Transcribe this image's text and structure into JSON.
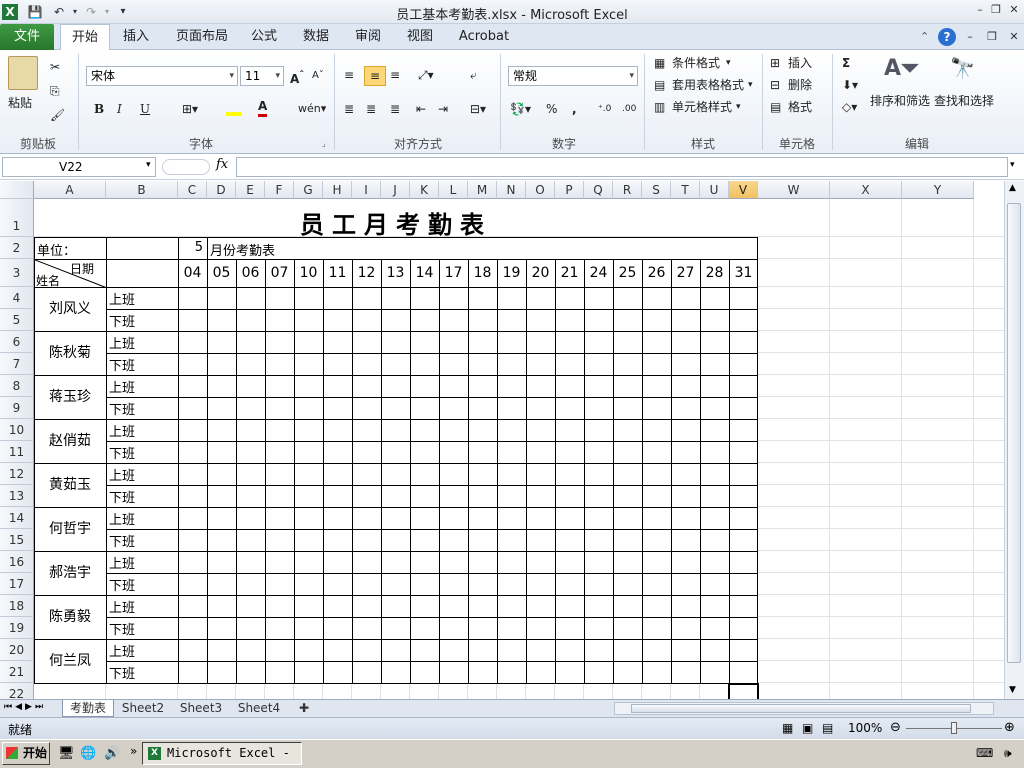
{
  "window": {
    "title": "员工基本考勤表.xlsx - Microsoft Excel",
    "controls": [
      "–",
      "❐",
      "✕"
    ]
  },
  "ribbon_tabs": [
    "文件",
    "开始",
    "插入",
    "页面布局",
    "公式",
    "数据",
    "审阅",
    "视图",
    "Acrobat"
  ],
  "ribbon": {
    "clipboard": {
      "paste": "粘贴",
      "label": "剪贴板"
    },
    "font": {
      "name": "宋体",
      "size": "11",
      "label": "字体",
      "bold": "B",
      "italic": "I",
      "underline": "U",
      "font_color": "#cc0000",
      "fill_color": "#ffff00"
    },
    "alignment": {
      "label": "对齐方式"
    },
    "number": {
      "format": "常规",
      "label": "数字",
      "percent": "%",
      "comma": ","
    },
    "styles": {
      "conditional": "条件格式",
      "table": "套用表格格式",
      "cell": "单元格样式",
      "label": "样式"
    },
    "cells": {
      "insert": "插入",
      "delete": "删除",
      "format": "格式",
      "label": "单元格"
    },
    "editing": {
      "sort": "排序和筛选",
      "find": "查找和选择",
      "label": "编辑",
      "sum": "Σ"
    }
  },
  "formula_bar": {
    "name_box": "V22",
    "fx": "fx",
    "value": ""
  },
  "columns": [
    "A",
    "B",
    "C",
    "D",
    "E",
    "F",
    "G",
    "H",
    "I",
    "J",
    "K",
    "L",
    "M",
    "N",
    "O",
    "P",
    "Q",
    "R",
    "S",
    "T",
    "U",
    "V",
    "W",
    "X",
    "Y"
  ],
  "selected_column": "V",
  "rows": [
    "1",
    "2",
    "3",
    "4",
    "5",
    "6",
    "7",
    "8",
    "9",
    "10",
    "11",
    "12",
    "13",
    "14",
    "15",
    "16",
    "17",
    "18",
    "19",
    "20",
    "21",
    "22"
  ],
  "sheet": {
    "title": "员工月考勤表",
    "unit_label": "单位：",
    "month_value": "5",
    "month_label": "月份考勤表",
    "header_date": "日期",
    "header_name": "姓名",
    "days": [
      "04",
      "05",
      "06",
      "07",
      "10",
      "11",
      "12",
      "13",
      "14",
      "17",
      "18",
      "19",
      "20",
      "21",
      "24",
      "25",
      "26",
      "27",
      "28",
      "31"
    ],
    "shift_on": "上班",
    "shift_off": "下班",
    "employees": [
      "刘风义",
      "陈秋菊",
      "蒋玉珍",
      "赵俏茹",
      "黄茹玉",
      "何哲宇",
      "郝浩宇",
      "陈勇毅",
      "何兰凤"
    ]
  },
  "sheet_tabs": [
    "考勤表",
    "Sheet2",
    "Sheet3",
    "Sheet4"
  ],
  "active_sheet": "考勤表",
  "status": {
    "ready": "就绪",
    "zoom": "100%"
  },
  "taskbar": {
    "start": "开始",
    "task": "Microsoft Excel - ..."
  }
}
